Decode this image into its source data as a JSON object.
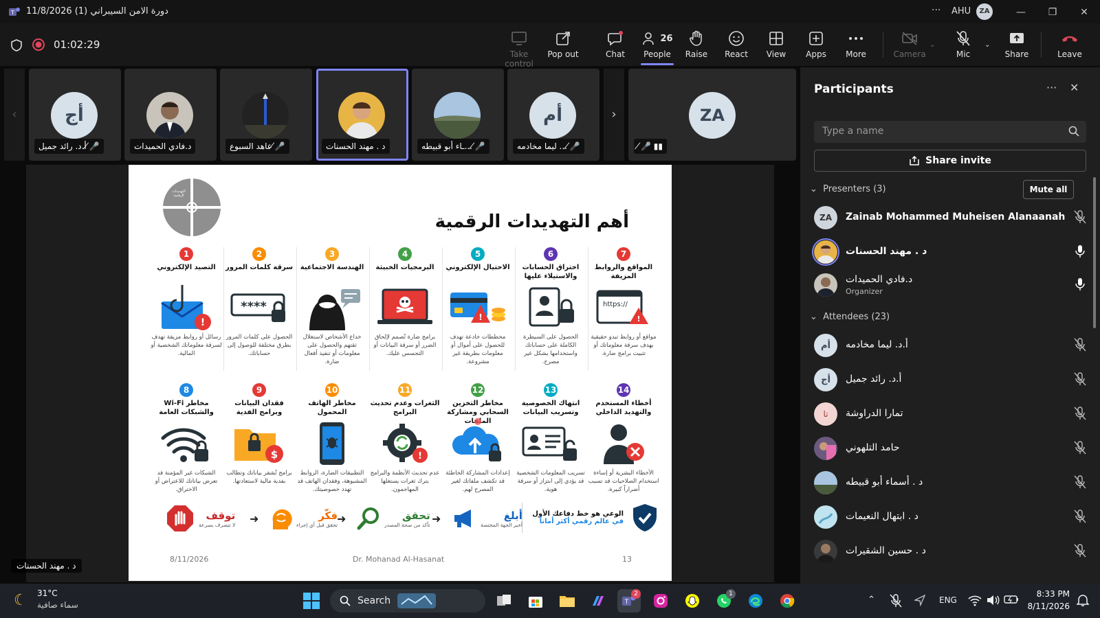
{
  "window": {
    "title": "دورة الامن السيبراني (1) 11/8/2026",
    "org": "AHU",
    "user_initials": "ZA",
    "more": "···"
  },
  "meeting": {
    "timer": "01:02:29"
  },
  "toolbar": {
    "take_control": "Take control",
    "pop_out": "Pop out",
    "chat": "Chat",
    "people": "People",
    "people_count": "26",
    "raise": "Raise",
    "react": "React",
    "view": "View",
    "apps": "Apps",
    "more": "More",
    "camera": "Camera",
    "mic": "Mic",
    "share": "Share",
    "leave": "Leave"
  },
  "strip": [
    {
      "name": "أ.د. رائد جميل",
      "initials": "أج"
    },
    {
      "name": "د.فادي الحميدات"
    },
    {
      "name": "عاهد السبوع"
    },
    {
      "name": "د . مهند الحسنات"
    },
    {
      "name": "...ـاء أبو قبيطه"
    },
    {
      "name": "... ليما مخادمه",
      "initials": "أم"
    },
    {
      "initials": "ZA"
    }
  ],
  "stage": {
    "speaker_label": "د . مهند الحسنات"
  },
  "slide": {
    "title": "أهم التهديدات الرقمية",
    "logo_text": "التهديدات الرقمية",
    "items_row1": [
      {
        "n": "1",
        "title": "التصيد الإلكتروني",
        "desc": "رسائل أو روابط مزيفة تهدف لسرقة معلوماتك الشخصية أو المالية.",
        "color": "#e53935"
      },
      {
        "n": "2",
        "title": "سرقة كلمات المرور",
        "desc": "الحصول على كلمات المرور بطرق مختلفة للوصول إلى حساباتك.",
        "color": "#fb8c00"
      },
      {
        "n": "3",
        "title": "الهندسة الاجتماعية",
        "desc": "خداع الأشخاص لاستغلال ثقتهم والحصول على معلومات أو تنفيذ أفعال ضارة.",
        "color": "#f9a825"
      },
      {
        "n": "4",
        "title": "البرمجيات الخبيثة",
        "desc": "برامج ضارة تُصمم لإلحاق الضرر أو سرقة البيانات أو التجسس عليك.",
        "color": "#43a047"
      },
      {
        "n": "5",
        "title": "الاحتيال الإلكتروني",
        "desc": "مخططات خادعة تهدف للحصول على أموال أو معلومات بطريقة غير مشروعة.",
        "color": "#00acc1"
      },
      {
        "n": "6",
        "title": "اختراق الحسابات والاستيلاء عليها",
        "desc": "الحصول على السيطرة الكاملة على حساباتك واستخدامها بشكل غير مصرح.",
        "color": "#5e35b1"
      },
      {
        "n": "7",
        "title": "المواقع والروابط المزيفة",
        "desc": "مواقع أو روابط تبدو حقيقية بهدف سرقة معلوماتك أو تثبيت برامج ضارة.",
        "color": "#e53935"
      }
    ],
    "items_row2": [
      {
        "n": "8",
        "title": "مخاطر Wi-Fi والشبكات العامة",
        "desc": "الشبكات غير المؤمنة قد تعرض بياناتك للاعتراض أو الاختراق.",
        "color": "#1e88e5"
      },
      {
        "n": "9",
        "title": "فقدان البيانات وبرامج الفدية",
        "desc": "برامج تُشفر بياناتك وتطالب بفدية مالية لاستعادتها.",
        "color": "#e53935"
      },
      {
        "n": "10",
        "title": "مخاطر الهاتف المحمول",
        "desc": "التطبيقات الضارة، الروابط المشبوهة، وفقدان الهاتف قد تهدد خصوصيتك.",
        "color": "#fb8c00"
      },
      {
        "n": "11",
        "title": "الثغرات وعدم تحديث البرامج",
        "desc": "عدم تحديث الأنظمة والبرامج يترك ثغرات يستغلها المهاجمون.",
        "color": "#f9a825"
      },
      {
        "n": "12",
        "title": "مخاطر التخزين السحابي ومشاركة الملفات",
        "desc": "إعدادات المشاركة الخاطئة قد تكشف ملفاتك لغير المصرح لهم.",
        "color": "#43a047"
      },
      {
        "n": "13",
        "title": "انتهاك الخصوصية وتسريب البيانات",
        "desc": "تسريب المعلومات الشخصية قد يؤدي إلى ابتزاز أو سرقة هوية.",
        "color": "#00acc1"
      },
      {
        "n": "14",
        "title": "أخطاء المستخدم والتهديد الداخلي",
        "desc": "الأخطاء البشرية أو إساءة استخدام الصلاحيات قد تسبب أضراراً كبيرة.",
        "color": "#5e35b1"
      }
    ],
    "steps": [
      {
        "word": "توقف",
        "sub": "لا تتصرف بسرعة"
      },
      {
        "word": "فكّر",
        "sub": "تحقق قبل أي إجراء"
      },
      {
        "word": "تحقق",
        "sub": "تأكد من صحة المصدر"
      },
      {
        "word": "أبلغ",
        "sub": "أخبر الجهة المختصة"
      }
    ],
    "awareness_line1": "الوعي هو خط دفاعك الأول",
    "awareness_line2": "في عالم رقمي أكثر أماناً",
    "footer_date": "8/11/2026",
    "footer_author": "Dr. Mohanad Al-Hasanat",
    "footer_page": "13"
  },
  "panel": {
    "title": "Participants",
    "search_placeholder": "Type a name",
    "share_invite": "Share invite",
    "presenters_label": "Presenters (3)",
    "mute_all": "Mute all",
    "attendees_label": "Attendees (23)",
    "presenters": [
      {
        "name": "Zainab Mohammed Muheisen Alanaanah",
        "initials": "ZA"
      },
      {
        "name": "د . مهند الحسنات"
      },
      {
        "name": "د.فادي الحميدات",
        "role": "Organizer"
      }
    ],
    "attendees": [
      {
        "name": "أ.د. ليما مخادمه",
        "initials": "أم"
      },
      {
        "name": "أ.د. رائد جميل",
        "initials": "أج"
      },
      {
        "name": "تمارا الدراوشة",
        "initials": "تا"
      },
      {
        "name": "حامد التلهوني"
      },
      {
        "name": "د . أسماء أبو قبيطه"
      },
      {
        "name": "د . ابتهال النعيمات"
      },
      {
        "name": "د . حسين الشقيرات"
      }
    ]
  },
  "taskbar": {
    "temp": "31°C",
    "weather": "سماء صافية",
    "search": "Search",
    "lang": "ENG",
    "time": "8:33 PM",
    "date": "8/11/2026",
    "teams_badge": "2",
    "whatsapp_badge": "1"
  },
  "colors": {
    "accent": "#7f85f5",
    "leave": "#e0465c",
    "record": "#e0465c"
  }
}
